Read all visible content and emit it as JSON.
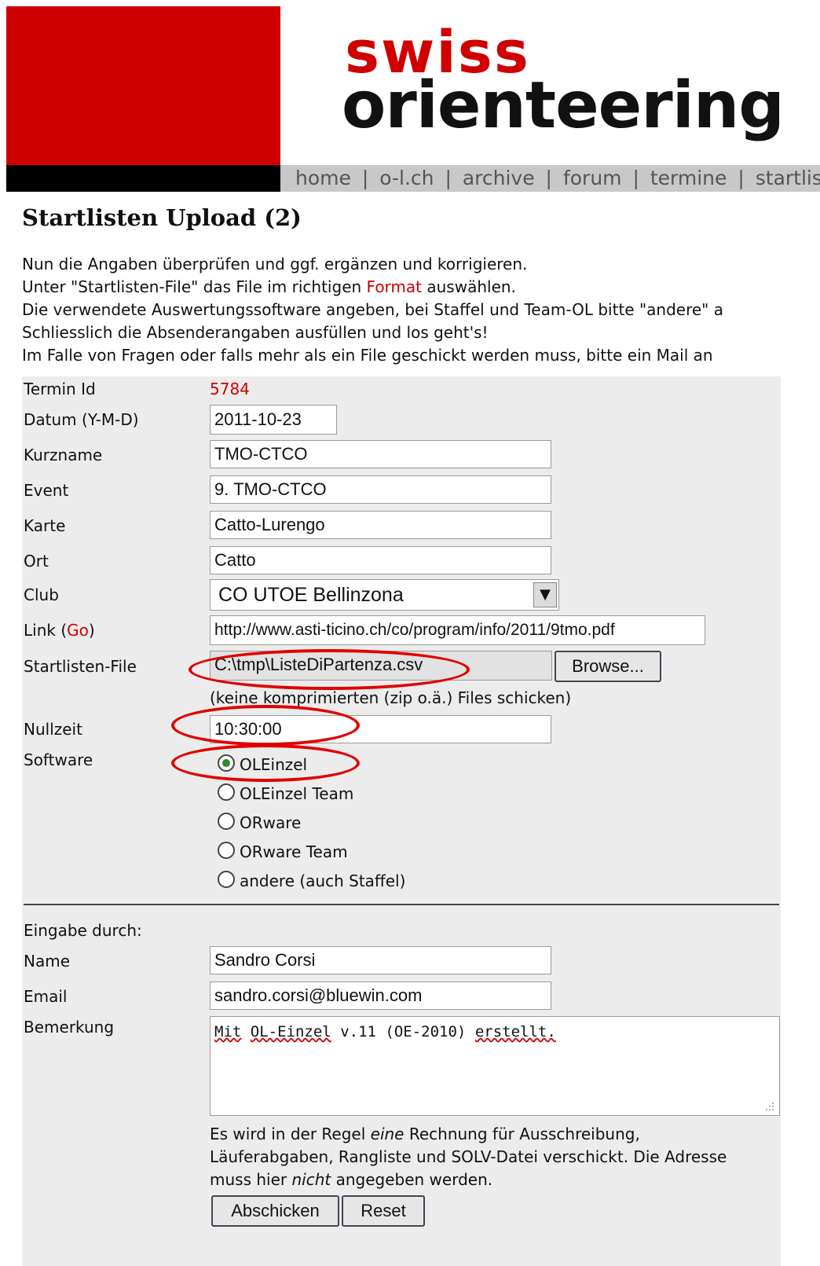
{
  "header": {
    "logo_top": "swiss",
    "logo_bottom": "orienteering",
    "nav": [
      {
        "label": "home"
      },
      {
        "label": "o-l.ch"
      },
      {
        "label": "archive"
      },
      {
        "label": "forum"
      },
      {
        "label": "termine"
      },
      {
        "label": "startlisten"
      }
    ],
    "nav_separator": "|"
  },
  "page": {
    "title": "Startlisten Upload (2)",
    "intro": {
      "line1": "Nun die Angaben überprüfen und ggf. ergänzen und korrigieren.",
      "line2_pre": "Unter \"Startlisten-File\" das File im richtigen ",
      "line2_link": "Format",
      "line2_post": " auswählen.",
      "line3": "Die verwendete Auswertungssoftware angeben, bei Staffel und Team-OL bitte \"andere\" a",
      "line4": "Schliesslich die Absenderangaben ausfüllen und los geht's!",
      "line5": "Im Falle von Fragen oder falls mehr als ein File geschickt werden muss, bitte ein Mail an"
    }
  },
  "form": {
    "termin_id": {
      "label": "Termin Id",
      "value": "5784"
    },
    "datum": {
      "label": "Datum (Y-M-D)",
      "value": "2011-10-23"
    },
    "kurzname": {
      "label": "Kurzname",
      "value": "TMO-CTCO"
    },
    "event": {
      "label": "Event",
      "value": "9. TMO-CTCO"
    },
    "karte": {
      "label": "Karte",
      "value": "Catto-Lurengo"
    },
    "ort": {
      "label": "Ort",
      "value": "Catto"
    },
    "club": {
      "label": "Club",
      "selected": "CO UTOE Bellinzona"
    },
    "link": {
      "label_pre": "Link (",
      "label_link": "Go",
      "label_post": ")",
      "value": "http://www.asti-ticino.ch/co/program/info/2011/9tmo.pdf"
    },
    "startlisten_file": {
      "label": "Startlisten-File",
      "value": "C:\\tmp\\ListeDiPartenza.csv",
      "browse_label": "Browse...",
      "hint": "(keine komprimierten (zip o.ä.) Files schicken)"
    },
    "nullzeit": {
      "label": "Nullzeit",
      "value": "10:30:00"
    },
    "software": {
      "label": "Software",
      "options": [
        {
          "label": "OLEinzel",
          "checked": true
        },
        {
          "label": "OLEinzel Team",
          "checked": false
        },
        {
          "label": "ORware",
          "checked": false
        },
        {
          "label": "ORware Team",
          "checked": false
        },
        {
          "label": "andere (auch Staffel)",
          "checked": false
        }
      ]
    },
    "eingabe_durch": "Eingabe durch:",
    "name": {
      "label": "Name",
      "value": "Sandro Corsi"
    },
    "email": {
      "label": "Email",
      "value": "sandro.corsi@bluewin.com"
    },
    "bemerkung": {
      "label": "Bemerkung",
      "words": [
        "Mit",
        "OL-Einzel",
        "v.11",
        "(OE-2010)",
        "erstellt."
      ]
    },
    "billing_note": {
      "part1": "Es wird in der Regel ",
      "em1": "eine",
      "part2": " Rechnung für Ausschreibung, Läuferabgaben, Rangliste und SOLV-Datei verschickt. Die Adresse muss hier ",
      "em2": "nicht",
      "part3": " angegeben werden."
    },
    "submit_label": "Abschicken",
    "reset_label": "Reset"
  },
  "colors": {
    "brand_red": "#d10000",
    "annotation_red": "#e00000",
    "nav_gray": "#c8c8c8",
    "form_bg": "#ececec"
  },
  "icons": {
    "dropdown": "chevron-down-icon",
    "resize_grip": "resize-grip-icon"
  }
}
